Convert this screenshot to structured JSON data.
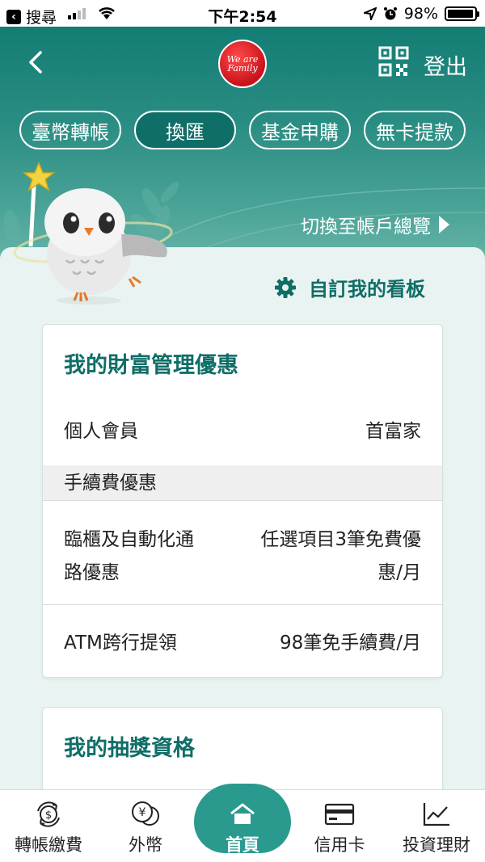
{
  "status_bar": {
    "back_app": "搜尋",
    "time": "下午2:54",
    "battery": "98%",
    "battery_level": 0.98,
    "icons": [
      "signal-icon",
      "wifi-icon",
      "location-icon",
      "alarm-icon",
      "battery-icon"
    ]
  },
  "header": {
    "logo_text": "We are Family",
    "logout": "登出",
    "icons": [
      "back-icon",
      "qr-code-icon"
    ]
  },
  "quick_actions": [
    {
      "label": "臺幣轉帳",
      "active": false
    },
    {
      "label": "換匯",
      "active": true
    },
    {
      "label": "基金申購",
      "active": false
    },
    {
      "label": "無卡提款",
      "active": false
    }
  ],
  "switch_link": "切換至帳戶總覽",
  "customize": "自訂我的看板",
  "wealth_card": {
    "title": "我的財富管理優惠",
    "member_label": "個人會員",
    "member_value": "首富家",
    "fee_section": "手續費優惠",
    "counter_label_1": "臨櫃及自動化通",
    "counter_label_2": "路優惠",
    "counter_value_1": "任選項目3筆免費優",
    "counter_value_2": "惠/月",
    "atm_label": "ATM跨行提領",
    "atm_value": "98筆免手續費/月"
  },
  "lottery_card": {
    "title": "我的抽獎資格"
  },
  "tabbar": [
    {
      "label": "轉帳繳費",
      "icon": "transfer-icon"
    },
    {
      "label": "外幣",
      "icon": "foreign-currency-icon"
    },
    {
      "label": "首頁",
      "icon": "home-icon",
      "active": true
    },
    {
      "label": "信用卡",
      "icon": "credit-card-icon"
    },
    {
      "label": "投資理財",
      "icon": "investment-chart-icon"
    }
  ],
  "colors": {
    "brand": "#0f6e67",
    "header_top": "#137d74",
    "background": "#e9f4f2",
    "home_tab": "#2a9a8f"
  }
}
